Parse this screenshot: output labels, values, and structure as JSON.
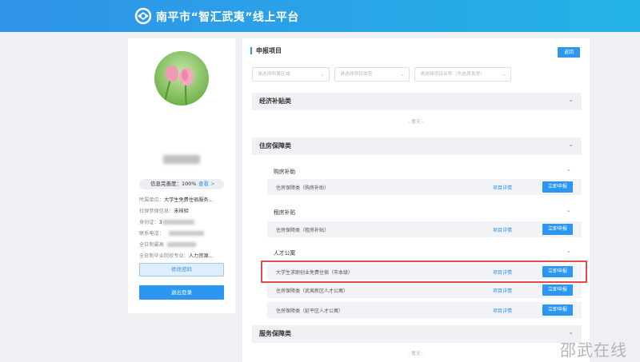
{
  "header": {
    "title": "南平市“智汇武夷”线上平台",
    "logo_icon": "logo-icon"
  },
  "profile": {
    "completeness_label": "信息完善度：100%",
    "view_link": "查看 >",
    "rows": [
      {
        "key": "所属单位：",
        "value": "大学生免费住宿服务..."
      },
      {
        "key": "社保参保信息：",
        "value": "未核验"
      },
      {
        "key": "身份证：",
        "value": "3"
      },
      {
        "key": "联系电话：",
        "value": ""
      },
      {
        "key": "全日制最高",
        "value": ""
      },
      {
        "key": "全日制毕业院校专业：",
        "value": "人力资源..."
      }
    ],
    "change_password": "修改密码",
    "logout": "退出登录"
  },
  "main": {
    "title": "申报项目",
    "back": "返回",
    "filters": [
      {
        "placeholder": "请选择所属区域"
      },
      {
        "placeholder": "请选择项目类型"
      },
      {
        "placeholder": "请选择项目名称（先选择类型）"
      }
    ],
    "categories": {
      "economic": {
        "title": "经济补贴类",
        "empty": "- 暂无 -"
      },
      "housing": {
        "title": "住房保障类"
      },
      "service": {
        "title": "服务保障类",
        "empty": "- 暂无 -"
      }
    },
    "subgroups": [
      {
        "title": "购房补助",
        "items": [
          {
            "name": "住房保障类（购房补助）"
          }
        ]
      },
      {
        "title": "租房补贴",
        "items": [
          {
            "name": "住房保障类（租房补贴）"
          }
        ]
      },
      {
        "title": "人才公寓",
        "items": [
          {
            "name": "大学生求职创业免费住宿（市本级）"
          },
          {
            "name": "住房保障类（武夷新区人才公寓）"
          },
          {
            "name": "住房保障类（延平区人才公寓）"
          }
        ]
      }
    ],
    "detail_label": "项目详情",
    "apply_label": "立即申报"
  },
  "watermark": "邵武在线",
  "colors": {
    "accent": "#2d96f0",
    "highlight": "#e54b4b"
  }
}
